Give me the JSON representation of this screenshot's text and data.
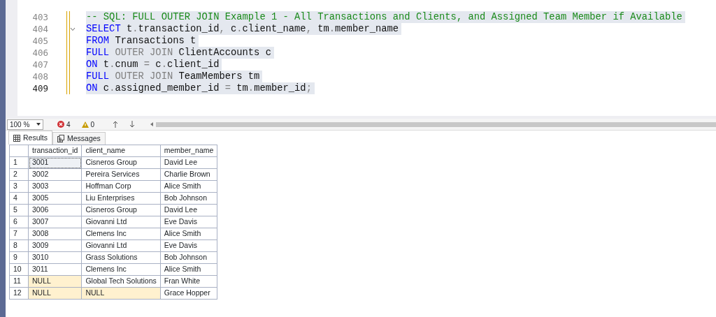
{
  "editor": {
    "lines": [
      {
        "number": "403",
        "current": false,
        "foldable": false,
        "tokens": [
          {
            "kind": "comment",
            "text": "-- SQL: FULL OUTER JOIN Example 1 - All Transactions and Clients, and Assigned Team Member if Available"
          }
        ]
      },
      {
        "number": "404",
        "current": false,
        "foldable": true,
        "tokens": [
          {
            "kind": "keyword",
            "text": "SELECT"
          },
          {
            "kind": "ident",
            "text": " t"
          },
          {
            "kind": "punct",
            "text": "."
          },
          {
            "kind": "ident",
            "text": "transaction_id"
          },
          {
            "kind": "punct",
            "text": ", "
          },
          {
            "kind": "ident",
            "text": "c"
          },
          {
            "kind": "punct",
            "text": "."
          },
          {
            "kind": "ident",
            "text": "client_name"
          },
          {
            "kind": "punct",
            "text": ", "
          },
          {
            "kind": "ident",
            "text": "tm"
          },
          {
            "kind": "punct",
            "text": "."
          },
          {
            "kind": "ident",
            "text": "member_name"
          }
        ]
      },
      {
        "number": "405",
        "current": false,
        "foldable": false,
        "tokens": [
          {
            "kind": "keyword",
            "text": "FROM"
          },
          {
            "kind": "ident",
            "text": " Transactions t"
          }
        ]
      },
      {
        "number": "406",
        "current": false,
        "foldable": false,
        "tokens": [
          {
            "kind": "keyword",
            "text": "FULL"
          },
          {
            "kind": "punct",
            "text": " OUTER JOIN"
          },
          {
            "kind": "ident",
            "text": " ClientAccounts c"
          }
        ]
      },
      {
        "number": "407",
        "current": false,
        "foldable": false,
        "tokens": [
          {
            "kind": "keyword",
            "text": "ON"
          },
          {
            "kind": "ident",
            "text": " t"
          },
          {
            "kind": "punct",
            "text": "."
          },
          {
            "kind": "ident",
            "text": "cnum "
          },
          {
            "kind": "punct",
            "text": "="
          },
          {
            "kind": "ident",
            "text": " c"
          },
          {
            "kind": "punct",
            "text": "."
          },
          {
            "kind": "ident",
            "text": "client_id"
          }
        ]
      },
      {
        "number": "408",
        "current": false,
        "foldable": false,
        "tokens": [
          {
            "kind": "keyword",
            "text": "FULL"
          },
          {
            "kind": "punct",
            "text": " OUTER JOIN"
          },
          {
            "kind": "ident",
            "text": " TeamMembers tm"
          }
        ]
      },
      {
        "number": "409",
        "current": true,
        "foldable": false,
        "tokens": [
          {
            "kind": "keyword",
            "text": "ON"
          },
          {
            "kind": "ident",
            "text": " c"
          },
          {
            "kind": "punct",
            "text": "."
          },
          {
            "kind": "ident",
            "text": "assigned_member_id "
          },
          {
            "kind": "punct",
            "text": "="
          },
          {
            "kind": "ident",
            "text": " tm"
          },
          {
            "kind": "punct",
            "text": "."
          },
          {
            "kind": "ident",
            "text": "member_id"
          },
          {
            "kind": "punct",
            "text": ";"
          }
        ]
      }
    ]
  },
  "toolbar": {
    "zoom": "100 %",
    "errors": "4",
    "warnings": "0"
  },
  "tabs": [
    {
      "label": "Results",
      "kind": "grid",
      "selected": true
    },
    {
      "label": "Messages",
      "kind": "doc",
      "selected": false
    }
  ],
  "grid": {
    "columns": [
      "transaction_id",
      "client_name",
      "member_name"
    ],
    "rows": [
      {
        "number": "1",
        "cells": [
          {
            "text": "3001",
            "null": false,
            "selected": true
          },
          {
            "text": "Cisneros Group",
            "null": false,
            "selected": false
          },
          {
            "text": "David Lee",
            "null": false,
            "selected": false
          }
        ]
      },
      {
        "number": "2",
        "cells": [
          {
            "text": "3002",
            "null": false,
            "selected": false
          },
          {
            "text": "Pereira Services",
            "null": false,
            "selected": false
          },
          {
            "text": "Charlie Brown",
            "null": false,
            "selected": false
          }
        ]
      },
      {
        "number": "3",
        "cells": [
          {
            "text": "3003",
            "null": false,
            "selected": false
          },
          {
            "text": "Hoffman Corp",
            "null": false,
            "selected": false
          },
          {
            "text": "Alice Smith",
            "null": false,
            "selected": false
          }
        ]
      },
      {
        "number": "4",
        "cells": [
          {
            "text": "3005",
            "null": false,
            "selected": false
          },
          {
            "text": "Liu Enterprises",
            "null": false,
            "selected": false
          },
          {
            "text": "Bob Johnson",
            "null": false,
            "selected": false
          }
        ]
      },
      {
        "number": "5",
        "cells": [
          {
            "text": "3006",
            "null": false,
            "selected": false
          },
          {
            "text": "Cisneros Group",
            "null": false,
            "selected": false
          },
          {
            "text": "David Lee",
            "null": false,
            "selected": false
          }
        ]
      },
      {
        "number": "6",
        "cells": [
          {
            "text": "3007",
            "null": false,
            "selected": false
          },
          {
            "text": "Giovanni Ltd",
            "null": false,
            "selected": false
          },
          {
            "text": "Eve Davis",
            "null": false,
            "selected": false
          }
        ]
      },
      {
        "number": "7",
        "cells": [
          {
            "text": "3008",
            "null": false,
            "selected": false
          },
          {
            "text": "Clemens Inc",
            "null": false,
            "selected": false
          },
          {
            "text": "Alice Smith",
            "null": false,
            "selected": false
          }
        ]
      },
      {
        "number": "8",
        "cells": [
          {
            "text": "3009",
            "null": false,
            "selected": false
          },
          {
            "text": "Giovanni Ltd",
            "null": false,
            "selected": false
          },
          {
            "text": "Eve Davis",
            "null": false,
            "selected": false
          }
        ]
      },
      {
        "number": "9",
        "cells": [
          {
            "text": "3010",
            "null": false,
            "selected": false
          },
          {
            "text": "Grass Solutions",
            "null": false,
            "selected": false
          },
          {
            "text": "Bob Johnson",
            "null": false,
            "selected": false
          }
        ]
      },
      {
        "number": "10",
        "cells": [
          {
            "text": "3011",
            "null": false,
            "selected": false
          },
          {
            "text": "Clemens Inc",
            "null": false,
            "selected": false
          },
          {
            "text": "Alice Smith",
            "null": false,
            "selected": false
          }
        ]
      },
      {
        "number": "11",
        "cells": [
          {
            "text": "NULL",
            "null": true,
            "selected": false
          },
          {
            "text": "Global Tech Solutions",
            "null": false,
            "selected": false
          },
          {
            "text": "Fran White",
            "null": false,
            "selected": false
          }
        ]
      },
      {
        "number": "12",
        "cells": [
          {
            "text": "NULL",
            "null": true,
            "selected": false
          },
          {
            "text": "NULL",
            "null": true,
            "selected": false
          },
          {
            "text": "Grace Hopper",
            "null": false,
            "selected": false
          }
        ]
      }
    ]
  }
}
